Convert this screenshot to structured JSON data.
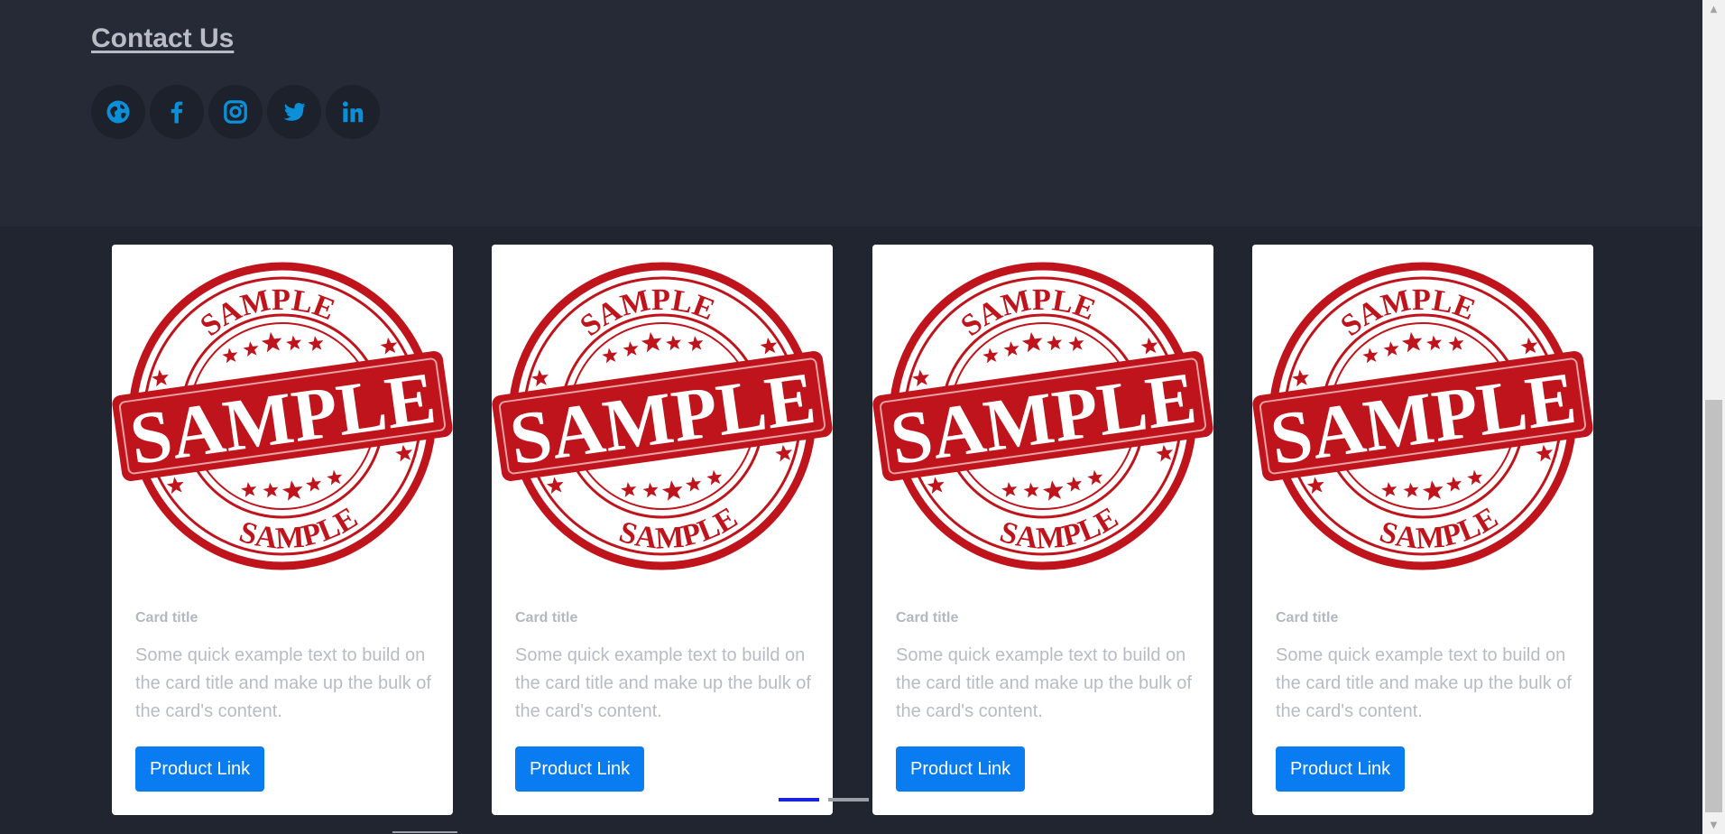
{
  "contact": {
    "title": "Contact Us",
    "social": [
      {
        "icon": "globe-icon",
        "name": "website"
      },
      {
        "icon": "facebook-icon",
        "name": "facebook"
      },
      {
        "icon": "instagram-icon",
        "name": "instagram"
      },
      {
        "icon": "twitter-icon",
        "name": "twitter"
      },
      {
        "icon": "linkedin-icon",
        "name": "linkedin"
      }
    ]
  },
  "cards": [
    {
      "image_alt_text": "SAMPLE",
      "stamp_top": "SAMPLE",
      "stamp_bottom": "SAMPLE",
      "title": "Card title",
      "text": "Some quick example text to build on the card title and make up the bulk of the card's content.",
      "button": "Product Link"
    },
    {
      "image_alt_text": "SAMPLE",
      "stamp_top": "SAMPLE",
      "stamp_bottom": "SAMPLE",
      "title": "Card title",
      "text": "Some quick example text to build on the card title and make up the bulk of the card's content.",
      "button": "Product Link"
    },
    {
      "image_alt_text": "SAMPLE",
      "stamp_top": "SAMPLE",
      "stamp_bottom": "SAMPLE",
      "title": "Card title",
      "text": "Some quick example text to build on the card title and make up the bulk of the card's content.",
      "button": "Product Link"
    },
    {
      "image_alt_text": "SAMPLE",
      "stamp_top": "SAMPLE",
      "stamp_bottom": "SAMPLE",
      "title": "Card title",
      "text": "Some quick example text to build on the card title and make up the bulk of the card's content.",
      "button": "Product Link"
    }
  ],
  "colors": {
    "accent": "#0a7cf2",
    "social_icon": "#0a8fd8",
    "stamp": "#c0141c",
    "indicator_active": "#1722e3",
    "background": "#212530"
  }
}
